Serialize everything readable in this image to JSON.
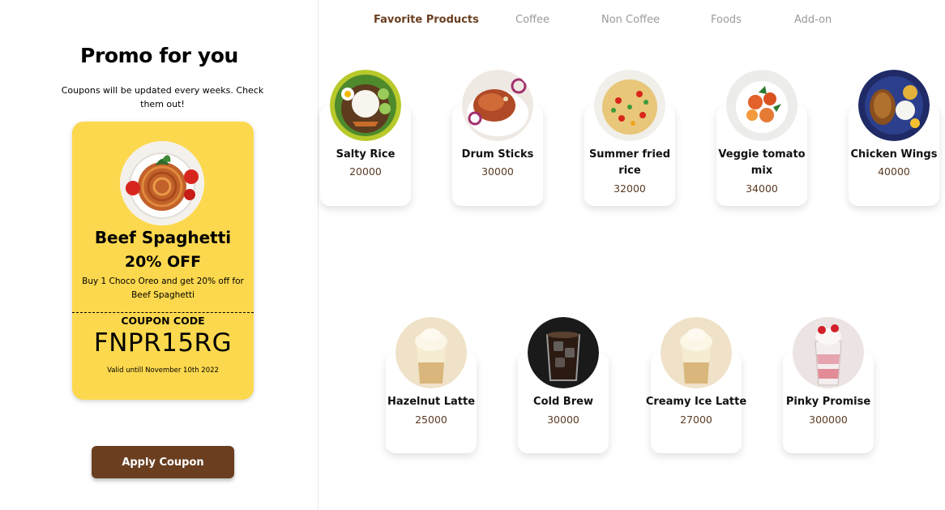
{
  "promo": {
    "title": "Promo for you",
    "subtitle": "Coupons will be updated every weeks. Check them out!",
    "coupon": {
      "product_name": "Beef Spaghetti",
      "discount": "20% OFF",
      "description": "Buy 1 Choco Oreo and get 20% off for Beef Spaghetti",
      "code_label": "COUPON CODE",
      "code": "FNPR15RG",
      "valid_until": "Valid untill November 10th 2022",
      "image_icon": "spaghetti-plate-icon"
    },
    "apply_label": "Apply Coupon"
  },
  "tabs": [
    {
      "label": "Favorite Products",
      "active": true
    },
    {
      "label": "Coffee",
      "active": false
    },
    {
      "label": "Non Coffee",
      "active": false
    },
    {
      "label": "Foods",
      "active": false
    },
    {
      "label": "Add-on",
      "active": false
    }
  ],
  "products": [
    {
      "name": "Salty Rice",
      "price": "20000",
      "icon": "rice-plate-icon"
    },
    {
      "name": "Drum Sticks",
      "price": "30000",
      "icon": "drumstick-plate-icon"
    },
    {
      "name": "Summer fried rice",
      "price": "32000",
      "icon": "fried-rice-plate-icon"
    },
    {
      "name": "Veggie tomato mix",
      "price": "34000",
      "icon": "veggie-plate-icon"
    },
    {
      "name": "Chicken Wings",
      "price": "40000",
      "icon": "chicken-wings-plate-icon"
    },
    {
      "name": "Hazelnut Latte",
      "price": "25000",
      "icon": "latte-glass-icon"
    },
    {
      "name": "Cold Brew",
      "price": "30000",
      "icon": "cold-brew-glass-icon"
    },
    {
      "name": "Creamy Ice Latte",
      "price": "27000",
      "icon": "ice-latte-glass-icon"
    },
    {
      "name": "Pinky Promise",
      "price": "300000",
      "icon": "pink-drink-glass-icon"
    }
  ],
  "colors": {
    "accent": "#6a3e1f",
    "coupon_bg": "#fcd84e",
    "tab_inactive": "#9a9a9a"
  }
}
